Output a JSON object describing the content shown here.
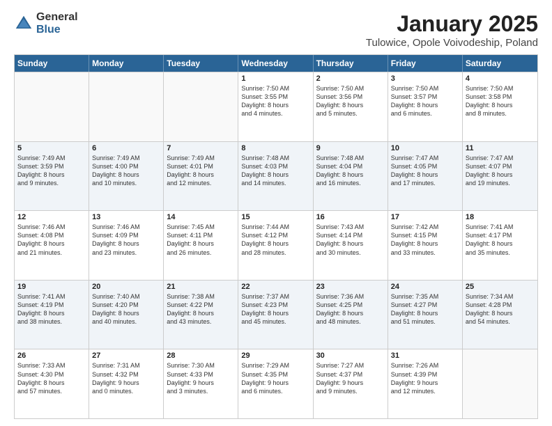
{
  "logo": {
    "general": "General",
    "blue": "Blue"
  },
  "title": "January 2025",
  "subtitle": "Tulowice, Opole Voivodeship, Poland",
  "headers": [
    "Sunday",
    "Monday",
    "Tuesday",
    "Wednesday",
    "Thursday",
    "Friday",
    "Saturday"
  ],
  "rows": [
    [
      {
        "day": "",
        "lines": []
      },
      {
        "day": "",
        "lines": []
      },
      {
        "day": "",
        "lines": []
      },
      {
        "day": "1",
        "lines": [
          "Sunrise: 7:50 AM",
          "Sunset: 3:55 PM",
          "Daylight: 8 hours",
          "and 4 minutes."
        ]
      },
      {
        "day": "2",
        "lines": [
          "Sunrise: 7:50 AM",
          "Sunset: 3:56 PM",
          "Daylight: 8 hours",
          "and 5 minutes."
        ]
      },
      {
        "day": "3",
        "lines": [
          "Sunrise: 7:50 AM",
          "Sunset: 3:57 PM",
          "Daylight: 8 hours",
          "and 6 minutes."
        ]
      },
      {
        "day": "4",
        "lines": [
          "Sunrise: 7:50 AM",
          "Sunset: 3:58 PM",
          "Daylight: 8 hours",
          "and 8 minutes."
        ]
      }
    ],
    [
      {
        "day": "5",
        "lines": [
          "Sunrise: 7:49 AM",
          "Sunset: 3:59 PM",
          "Daylight: 8 hours",
          "and 9 minutes."
        ]
      },
      {
        "day": "6",
        "lines": [
          "Sunrise: 7:49 AM",
          "Sunset: 4:00 PM",
          "Daylight: 8 hours",
          "and 10 minutes."
        ]
      },
      {
        "day": "7",
        "lines": [
          "Sunrise: 7:49 AM",
          "Sunset: 4:01 PM",
          "Daylight: 8 hours",
          "and 12 minutes."
        ]
      },
      {
        "day": "8",
        "lines": [
          "Sunrise: 7:48 AM",
          "Sunset: 4:03 PM",
          "Daylight: 8 hours",
          "and 14 minutes."
        ]
      },
      {
        "day": "9",
        "lines": [
          "Sunrise: 7:48 AM",
          "Sunset: 4:04 PM",
          "Daylight: 8 hours",
          "and 16 minutes."
        ]
      },
      {
        "day": "10",
        "lines": [
          "Sunrise: 7:47 AM",
          "Sunset: 4:05 PM",
          "Daylight: 8 hours",
          "and 17 minutes."
        ]
      },
      {
        "day": "11",
        "lines": [
          "Sunrise: 7:47 AM",
          "Sunset: 4:07 PM",
          "Daylight: 8 hours",
          "and 19 minutes."
        ]
      }
    ],
    [
      {
        "day": "12",
        "lines": [
          "Sunrise: 7:46 AM",
          "Sunset: 4:08 PM",
          "Daylight: 8 hours",
          "and 21 minutes."
        ]
      },
      {
        "day": "13",
        "lines": [
          "Sunrise: 7:46 AM",
          "Sunset: 4:09 PM",
          "Daylight: 8 hours",
          "and 23 minutes."
        ]
      },
      {
        "day": "14",
        "lines": [
          "Sunrise: 7:45 AM",
          "Sunset: 4:11 PM",
          "Daylight: 8 hours",
          "and 26 minutes."
        ]
      },
      {
        "day": "15",
        "lines": [
          "Sunrise: 7:44 AM",
          "Sunset: 4:12 PM",
          "Daylight: 8 hours",
          "and 28 minutes."
        ]
      },
      {
        "day": "16",
        "lines": [
          "Sunrise: 7:43 AM",
          "Sunset: 4:14 PM",
          "Daylight: 8 hours",
          "and 30 minutes."
        ]
      },
      {
        "day": "17",
        "lines": [
          "Sunrise: 7:42 AM",
          "Sunset: 4:15 PM",
          "Daylight: 8 hours",
          "and 33 minutes."
        ]
      },
      {
        "day": "18",
        "lines": [
          "Sunrise: 7:41 AM",
          "Sunset: 4:17 PM",
          "Daylight: 8 hours",
          "and 35 minutes."
        ]
      }
    ],
    [
      {
        "day": "19",
        "lines": [
          "Sunrise: 7:41 AM",
          "Sunset: 4:19 PM",
          "Daylight: 8 hours",
          "and 38 minutes."
        ]
      },
      {
        "day": "20",
        "lines": [
          "Sunrise: 7:40 AM",
          "Sunset: 4:20 PM",
          "Daylight: 8 hours",
          "and 40 minutes."
        ]
      },
      {
        "day": "21",
        "lines": [
          "Sunrise: 7:38 AM",
          "Sunset: 4:22 PM",
          "Daylight: 8 hours",
          "and 43 minutes."
        ]
      },
      {
        "day": "22",
        "lines": [
          "Sunrise: 7:37 AM",
          "Sunset: 4:23 PM",
          "Daylight: 8 hours",
          "and 45 minutes."
        ]
      },
      {
        "day": "23",
        "lines": [
          "Sunrise: 7:36 AM",
          "Sunset: 4:25 PM",
          "Daylight: 8 hours",
          "and 48 minutes."
        ]
      },
      {
        "day": "24",
        "lines": [
          "Sunrise: 7:35 AM",
          "Sunset: 4:27 PM",
          "Daylight: 8 hours",
          "and 51 minutes."
        ]
      },
      {
        "day": "25",
        "lines": [
          "Sunrise: 7:34 AM",
          "Sunset: 4:28 PM",
          "Daylight: 8 hours",
          "and 54 minutes."
        ]
      }
    ],
    [
      {
        "day": "26",
        "lines": [
          "Sunrise: 7:33 AM",
          "Sunset: 4:30 PM",
          "Daylight: 8 hours",
          "and 57 minutes."
        ]
      },
      {
        "day": "27",
        "lines": [
          "Sunrise: 7:31 AM",
          "Sunset: 4:32 PM",
          "Daylight: 9 hours",
          "and 0 minutes."
        ]
      },
      {
        "day": "28",
        "lines": [
          "Sunrise: 7:30 AM",
          "Sunset: 4:33 PM",
          "Daylight: 9 hours",
          "and 3 minutes."
        ]
      },
      {
        "day": "29",
        "lines": [
          "Sunrise: 7:29 AM",
          "Sunset: 4:35 PM",
          "Daylight: 9 hours",
          "and 6 minutes."
        ]
      },
      {
        "day": "30",
        "lines": [
          "Sunrise: 7:27 AM",
          "Sunset: 4:37 PM",
          "Daylight: 9 hours",
          "and 9 minutes."
        ]
      },
      {
        "day": "31",
        "lines": [
          "Sunrise: 7:26 AM",
          "Sunset: 4:39 PM",
          "Daylight: 9 hours",
          "and 12 minutes."
        ]
      },
      {
        "day": "",
        "lines": []
      }
    ]
  ]
}
